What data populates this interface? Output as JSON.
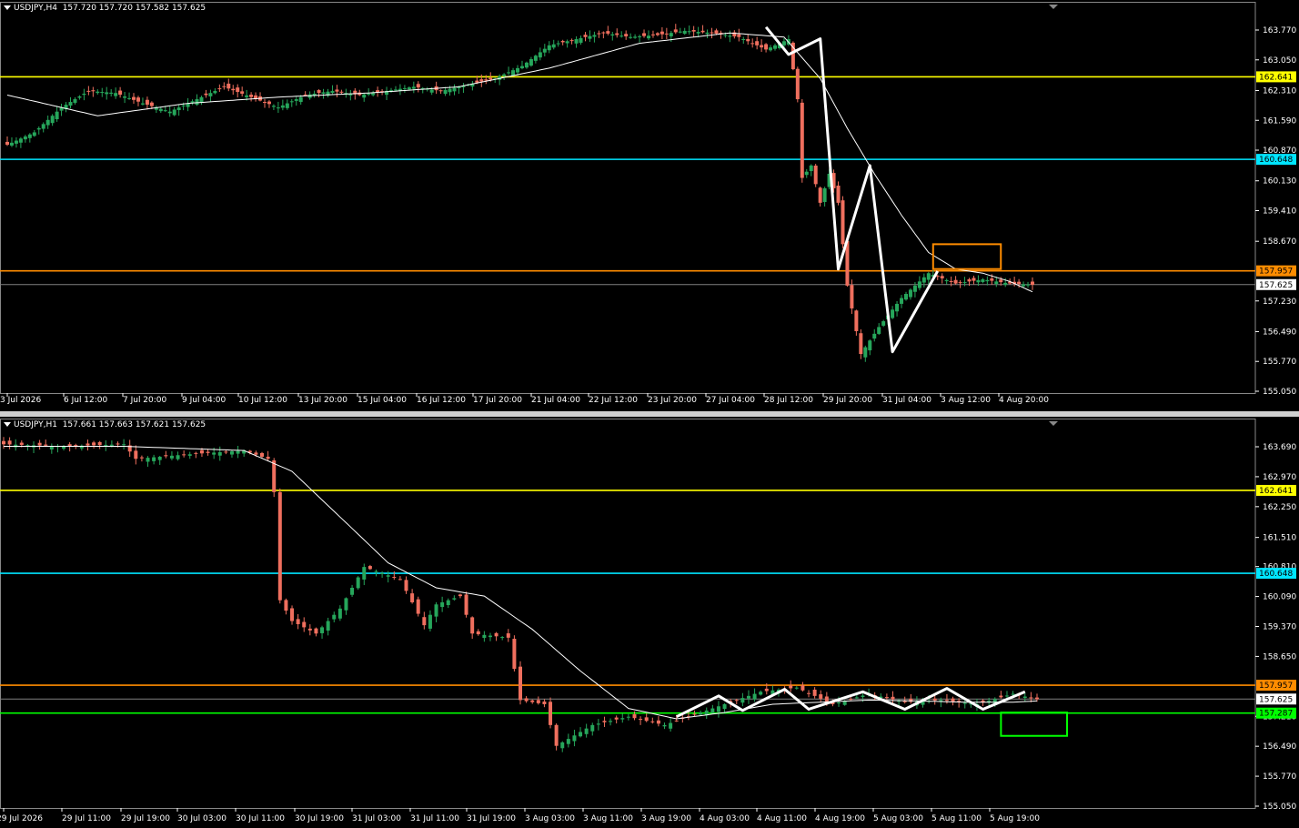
{
  "colors": {
    "background": "#000000",
    "bull": "#26a65b",
    "bear": "#ef6f5e",
    "grid_text": "#ffffff",
    "yellow": "#ffff00",
    "cyan": "#00e5ff",
    "orange": "#ff8c00",
    "green": "#00ff00",
    "price_line": "#808080",
    "ma": "#ffffff",
    "zigzag": "#ffffff"
  },
  "icons": {
    "menu": "triangle-down-icon"
  },
  "panels": [
    {
      "id": "h4",
      "header": {
        "symbol": "USDJPY,H4",
        "ohlc": "157.720 157.720 157.582 157.625"
      },
      "y_ticks": [
        "163.770",
        "163.050",
        "162.310",
        "161.590",
        "160.870",
        "160.130",
        "159.410",
        "158.670",
        "157.230",
        "156.490",
        "155.770",
        "155.050"
      ],
      "x_ticks": [
        "3 Jul 2026",
        "6 Jul 12:00",
        "7 Jul 20:00",
        "9 Jul 04:00",
        "10 Jul 12:00",
        "13 Jul 20:00",
        "15 Jul 04:00",
        "16 Jul 12:00",
        "17 Jul 20:00",
        "21 Jul 04:00",
        "22 Jul 12:00",
        "23 Jul 20:00",
        "27 Jul 04:00",
        "28 Jul 12:00",
        "29 Jul 20:00",
        "31 Jul 04:00",
        "3 Aug 12:00",
        "4 Aug 20:00"
      ],
      "levels": [
        {
          "name": "yellow",
          "price": 162.641,
          "label": "162.641"
        },
        {
          "name": "cyan",
          "price": 160.648,
          "label": "160.648"
        },
        {
          "name": "orange",
          "price": 157.957,
          "label": "157.957"
        }
      ],
      "current_price": {
        "price": 157.625,
        "label": "157.625"
      }
    },
    {
      "id": "h1",
      "header": {
        "symbol": "USDJPY,H1",
        "ohlc": "157.661 157.663 157.621 157.625"
      },
      "y_ticks": [
        "163.690",
        "162.970",
        "162.250",
        "161.510",
        "160.810",
        "160.090",
        "159.370",
        "158.650",
        "157.210",
        "156.490",
        "155.770",
        "155.050"
      ],
      "x_ticks": [
        "29 Jul 2026",
        "29 Jul 11:00",
        "29 Jul 19:00",
        "30 Jul 03:00",
        "30 Jul 11:00",
        "30 Jul 19:00",
        "31 Jul 03:00",
        "31 Jul 11:00",
        "31 Jul 19:00",
        "3 Aug 03:00",
        "3 Aug 11:00",
        "3 Aug 19:00",
        "4 Aug 03:00",
        "4 Aug 11:00",
        "4 Aug 19:00",
        "5 Aug 03:00",
        "5 Aug 11:00",
        "5 Aug 19:00"
      ],
      "levels": [
        {
          "name": "yellow",
          "price": 162.641,
          "label": "162.641"
        },
        {
          "name": "cyan",
          "price": 160.648,
          "label": "160.648"
        },
        {
          "name": "orange",
          "price": 157.957,
          "label": "157.957"
        },
        {
          "name": "green",
          "price": 157.287,
          "label": "157.287"
        }
      ],
      "current_price": {
        "price": 157.625,
        "label": "157.625"
      }
    }
  ],
  "chart_data": [
    {
      "type": "candlestick",
      "symbol": "USDJPY",
      "timeframe": "H4",
      "ylim": [
        155.05,
        164.15
      ],
      "x_ticks": [
        "3 Jul 2026",
        "6 Jul 12:00",
        "7 Jul 20:00",
        "9 Jul 04:00",
        "10 Jul 12:00",
        "13 Jul 20:00",
        "15 Jul 04:00",
        "16 Jul 12:00",
        "17 Jul 20:00",
        "21 Jul 04:00",
        "22 Jul 12:00",
        "23 Jul 20:00",
        "27 Jul 04:00",
        "28 Jul 12:00",
        "29 Jul 20:00",
        "31 Jul 04:00",
        "3 Aug 12:00",
        "4 Aug 20:00"
      ],
      "close_path": [
        [
          0,
          161.0
        ],
        [
          6,
          161.3
        ],
        [
          12,
          161.9
        ],
        [
          18,
          162.3
        ],
        [
          24,
          162.25
        ],
        [
          30,
          162.0
        ],
        [
          36,
          161.8
        ],
        [
          42,
          162.1
        ],
        [
          48,
          162.4
        ],
        [
          54,
          162.15
        ],
        [
          60,
          161.9
        ],
        [
          66,
          162.2
        ],
        [
          72,
          162.3
        ],
        [
          78,
          162.2
        ],
        [
          84,
          162.3
        ],
        [
          90,
          162.4
        ],
        [
          96,
          162.3
        ],
        [
          102,
          162.45
        ],
        [
          108,
          162.6
        ],
        [
          114,
          162.9
        ],
        [
          120,
          163.4
        ],
        [
          126,
          163.55
        ],
        [
          132,
          163.7
        ],
        [
          138,
          163.6
        ],
        [
          144,
          163.65
        ],
        [
          150,
          163.75
        ],
        [
          156,
          163.7
        ],
        [
          162,
          163.6
        ],
        [
          168,
          163.3
        ],
        [
          173,
          163.55
        ],
        [
          175,
          162.1
        ],
        [
          176,
          160.2
        ],
        [
          178,
          160.5
        ],
        [
          180,
          159.6
        ],
        [
          182,
          160.3
        ],
        [
          184,
          159.6
        ],
        [
          186,
          157.6
        ],
        [
          189,
          155.95
        ],
        [
          193,
          156.6
        ],
        [
          198,
          157.3
        ],
        [
          204,
          157.9
        ],
        [
          210,
          157.65
        ],
        [
          216,
          157.75
        ],
        [
          222,
          157.65
        ],
        [
          227,
          157.62
        ]
      ],
      "ma_path": [
        [
          0,
          162.2
        ],
        [
          20,
          161.7
        ],
        [
          40,
          162.0
        ],
        [
          60,
          162.15
        ],
        [
          80,
          162.25
        ],
        [
          100,
          162.4
        ],
        [
          120,
          162.85
        ],
        [
          140,
          163.45
        ],
        [
          160,
          163.7
        ],
        [
          172,
          163.6
        ],
        [
          180,
          162.6
        ],
        [
          186,
          161.4
        ],
        [
          192,
          160.3
        ],
        [
          198,
          159.3
        ],
        [
          204,
          158.4
        ],
        [
          210,
          158.0
        ],
        [
          216,
          157.9
        ],
        [
          222,
          157.7
        ],
        [
          227,
          157.45
        ]
      ],
      "zigzag": [
        [
          168,
          163.84
        ],
        [
          173,
          163.18
        ],
        [
          180,
          163.56
        ],
        [
          184,
          158.0
        ],
        [
          191,
          160.5
        ],
        [
          196,
          156.0
        ],
        [
          206,
          157.95
        ]
      ],
      "levels": [
        162.641,
        160.648,
        157.957
      ],
      "current_price": 157.625,
      "highlight_box": {
        "x0": 205,
        "x1": 220,
        "y0": 158.6,
        "y1": 158.0,
        "color": "#ff8c00"
      }
    },
    {
      "type": "candlestick",
      "symbol": "USDJPY",
      "timeframe": "H1",
      "ylim": [
        155.05,
        164.2
      ],
      "x_ticks": [
        "29 Jul 2026",
        "29 Jul 11:00",
        "29 Jul 19:00",
        "30 Jul 03:00",
        "30 Jul 11:00",
        "30 Jul 19:00",
        "31 Jul 03:00",
        "31 Jul 11:00",
        "31 Jul 19:00",
        "3 Aug 03:00",
        "3 Aug 11:00",
        "3 Aug 19:00",
        "4 Aug 03:00",
        "4 Aug 11:00",
        "4 Aug 19:00",
        "5 Aug 03:00",
        "5 Aug 11:00",
        "5 Aug 19:00"
      ],
      "close_path": [
        [
          0,
          163.75
        ],
        [
          10,
          163.7
        ],
        [
          20,
          163.75
        ],
        [
          22,
          163.4
        ],
        [
          30,
          163.5
        ],
        [
          40,
          163.6
        ],
        [
          44,
          163.4
        ],
        [
          45,
          162.6
        ],
        [
          46,
          160.0
        ],
        [
          48,
          159.5
        ],
        [
          52,
          159.2
        ],
        [
          56,
          159.8
        ],
        [
          60,
          160.8
        ],
        [
          66,
          160.5
        ],
        [
          70,
          159.4
        ],
        [
          72,
          159.9
        ],
        [
          76,
          160.1
        ],
        [
          78,
          159.2
        ],
        [
          84,
          159.1
        ],
        [
          86,
          157.6
        ],
        [
          90,
          157.5
        ],
        [
          92,
          156.5
        ],
        [
          98,
          157.0
        ],
        [
          104,
          157.2
        ],
        [
          110,
          157.0
        ],
        [
          114,
          157.2
        ],
        [
          120,
          157.5
        ],
        [
          126,
          157.8
        ],
        [
          132,
          157.9
        ],
        [
          138,
          157.5
        ],
        [
          144,
          157.75
        ],
        [
          150,
          157.55
        ],
        [
          156,
          157.6
        ],
        [
          162,
          157.5
        ],
        [
          168,
          157.75
        ],
        [
          172,
          157.62
        ]
      ],
      "ma_path": [
        [
          0,
          163.7
        ],
        [
          20,
          163.7
        ],
        [
          40,
          163.6
        ],
        [
          48,
          163.1
        ],
        [
          56,
          162.0
        ],
        [
          64,
          160.9
        ],
        [
          72,
          160.3
        ],
        [
          80,
          160.1
        ],
        [
          88,
          159.3
        ],
        [
          96,
          158.3
        ],
        [
          104,
          157.4
        ],
        [
          112,
          157.15
        ],
        [
          120,
          157.3
        ],
        [
          128,
          157.5
        ],
        [
          136,
          157.55
        ],
        [
          144,
          157.6
        ],
        [
          152,
          157.58
        ],
        [
          160,
          157.55
        ],
        [
          168,
          157.55
        ],
        [
          172,
          157.58
        ]
      ],
      "zigzag": [
        [
          112,
          157.2
        ],
        [
          119,
          157.7
        ],
        [
          123,
          157.35
        ],
        [
          130,
          157.86
        ],
        [
          134,
          157.38
        ],
        [
          143,
          157.8
        ],
        [
          150,
          157.38
        ],
        [
          157,
          157.88
        ],
        [
          163,
          157.38
        ],
        [
          170,
          157.8
        ]
      ],
      "levels": [
        162.641,
        160.648,
        157.957,
        157.287
      ],
      "current_price": 157.625,
      "highlight_box": {
        "x0": 166,
        "x1": 177,
        "y0": 157.3,
        "y1": 156.74,
        "color": "#00ff00"
      }
    }
  ]
}
